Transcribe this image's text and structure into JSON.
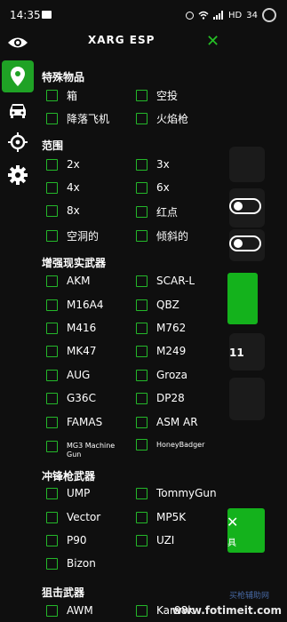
{
  "status_bar": {
    "time": "14:35",
    "battery": "34",
    "network": "HD"
  },
  "header": {
    "title": "XARG ESP"
  },
  "rail": [
    "eye-icon",
    "location-pin-icon",
    "car-icon",
    "crosshair-icon",
    "gear-icon"
  ],
  "accent_color": "#1fa225",
  "sections": {
    "special": {
      "title": "特殊物品",
      "items": [
        "箱",
        "空投",
        "降落飞机",
        "火焰枪"
      ]
    },
    "range": {
      "title": "范围",
      "items": [
        "2x",
        "3x",
        "4x",
        "6x",
        "8x",
        "红点",
        "空洞的",
        "倾斜的"
      ]
    },
    "ar": {
      "title": "增强现实武器",
      "items": [
        "AKM",
        "SCAR-L",
        "M16A4",
        "QBZ",
        "M416",
        "M762",
        "MK47",
        "M249",
        "AUG",
        "Groza",
        "G36C",
        "DP28",
        "FAMAS",
        "ASM AR",
        "MG3 Machine Gun",
        "HoneyBadger"
      ]
    },
    "smg": {
      "title": "冲锋枪武器",
      "items": [
        "UMP",
        "TommyGun",
        "Vector",
        "MP5K",
        "P90",
        "UZI",
        "Bizon"
      ]
    },
    "sniper": {
      "title": "狙击武器",
      "items": [
        "AWM",
        "Kar98k"
      ]
    }
  },
  "background": {
    "number": "11",
    "green_label": "具"
  },
  "watermark": {
    "text": "www.fotimeit.com",
    "small": "买枪辅助网"
  }
}
